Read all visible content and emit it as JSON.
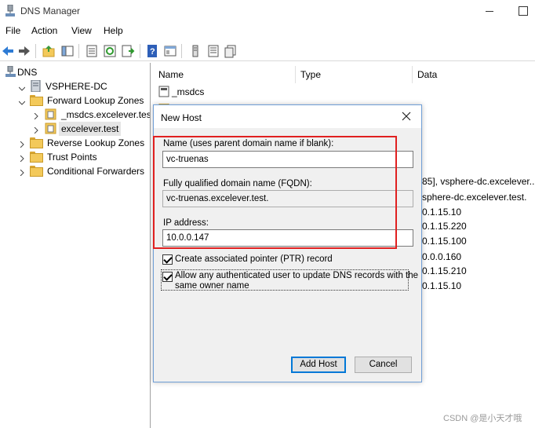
{
  "window": {
    "title": "DNS Manager"
  },
  "menu": [
    "File",
    "Action",
    "View",
    "Help"
  ],
  "toolbar": {
    "icons": [
      "back-icon",
      "forward-icon",
      "up-folder-icon",
      "show-hide-tree-icon",
      "properties-icon",
      "refresh-icon",
      "export-icon",
      "help-icon",
      "console-icon",
      "filter-icon",
      "list-icon",
      "copy-icon"
    ]
  },
  "tree": {
    "root": "DNS",
    "server": "VSPHERE-DC",
    "forward_zones": "Forward Lookup Zones",
    "zone_msdcs": "_msdcs.excelever.test",
    "zone_excelever": "excelever.test",
    "reverse_zones": "Reverse Lookup Zones",
    "trust_points": "Trust Points",
    "conditional_forwarders": "Conditional Forwarders"
  },
  "list": {
    "columns": [
      "Name",
      "Type",
      "Data"
    ],
    "first_row_name": "_msdcs",
    "data_values": [
      "85], vsphere-dc.excelever....",
      "sphere-dc.excelever.test.",
      "0.1.15.10",
      "0.1.15.220",
      "0.1.15.100",
      "0.0.0.160",
      "0.1.15.210",
      "0.1.15.10"
    ]
  },
  "dialog": {
    "title": "New Host",
    "name_label": "Name (uses parent domain name if blank):",
    "name_value": "vc-truenas",
    "fqdn_label": "Fully qualified domain name (FQDN):",
    "fqdn_value": "vc-truenas.excelever.test.",
    "ip_label": "IP address:",
    "ip_value": "10.0.0.147",
    "ptr_label": "Create associated pointer (PTR) record",
    "ptr_checked": true,
    "allow_label_line1": "Allow any authenticated user to update DNS records with the",
    "allow_label_line2": "same owner name",
    "allow_checked": true,
    "add_host_label": "Add Host",
    "cancel_label": "Cancel"
  },
  "watermark": "CSDN @是小天才哦",
  "colors": {
    "highlight": "#e02020",
    "dialog_border": "#6f9ed6",
    "default_button_border": "#0078d7",
    "selected_zone_bg": "#e5e5e5"
  }
}
